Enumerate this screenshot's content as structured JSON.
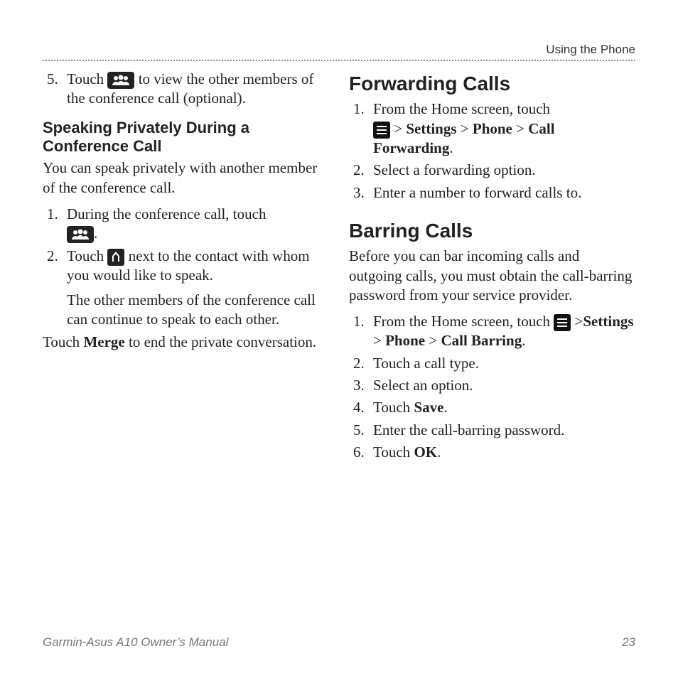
{
  "header": {
    "section": "Using the Phone"
  },
  "left": {
    "step5_pre": "Touch ",
    "step5_post": " to view the other members of the conference call (optional).",
    "subheading1": "Speaking Privately During a Conference Call",
    "intro1": "You can speak privately with another member of the conference call.",
    "step1": "During the conference call, touch ",
    "step1_end": ".",
    "step2_pre": "Touch ",
    "step2_post": " next to the contact with whom you would like to speak.",
    "step2_cont": "The other members of the conference call can continue to speak to each other.",
    "merge_pre": "Touch ",
    "merge_bold": "Merge",
    "merge_post": " to end the private conversation."
  },
  "right": {
    "heading1": "Forwarding Calls",
    "fc1_pre": "From the Home screen, touch ",
    "fc1_gt1": " > ",
    "fc1_settings": "Settings",
    "fc1_gt2": " > ",
    "fc1_phone": "Phone",
    "fc1_gt3": " > ",
    "fc1_cf": "Call Forwarding",
    "fc1_end": ".",
    "fc2": "Select a forwarding option.",
    "fc3": "Enter a number to forward calls to.",
    "heading2": "Barring Calls",
    "intro2": "Before you can bar incoming calls and outgoing calls, you must obtain the call-barring password from your service provider.",
    "bc1_pre": "From the Home screen, touch ",
    "bc1_gt1": " >",
    "bc1_settings": "Settings",
    "bc1_gt2": " > ",
    "bc1_phone": "Phone",
    "bc1_gt3": " > ",
    "bc1_cb": "Call Barring",
    "bc1_end": ".",
    "bc2": "Touch a call type.",
    "bc3": "Select an option.",
    "bc4_pre": "Touch ",
    "bc4_bold": "Save",
    "bc4_end": ".",
    "bc5": "Enter the call-barring password.",
    "bc6_pre": "Touch ",
    "bc6_bold": "OK",
    "bc6_end": "."
  },
  "footer": {
    "manual": "Garmin-Asus A10 Owner’s Manual",
    "page": "23"
  }
}
